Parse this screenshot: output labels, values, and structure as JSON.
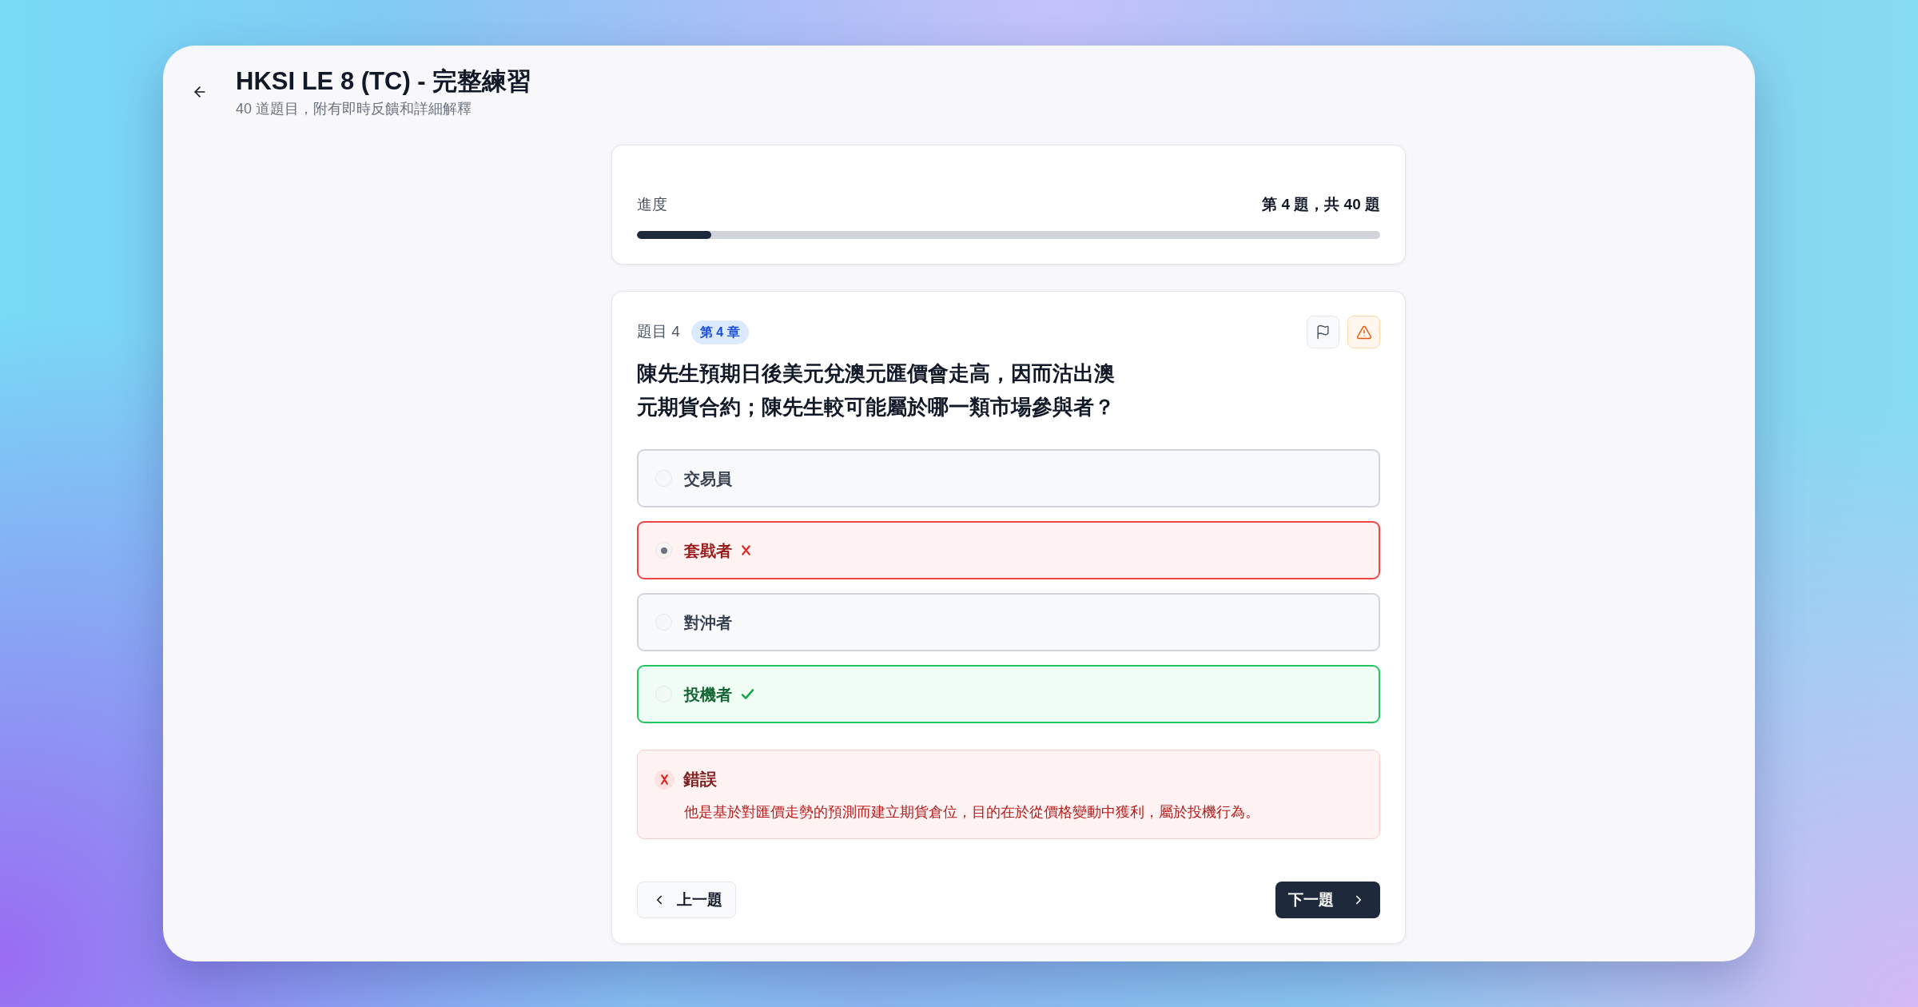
{
  "header": {
    "title": "HKSI LE 8 (TC) - 完整練習",
    "subtitle": "40 道題目，附有即時反饋和詳細解釋"
  },
  "progress": {
    "label": "進度",
    "count": "第 4 題，共 40 題",
    "level": 0.1
  },
  "question": {
    "number": "題目 4",
    "chapter": "第 4 章",
    "text": "陳先生預期日後美元兌澳元匯價會走高，因而沽出澳元期貨合約；陳先生較可能屬於哪一類市場參與者？",
    "options": [
      {
        "label": "交易員",
        "selected": false,
        "correct": false
      },
      {
        "label": "套戥者",
        "selected": true,
        "correct": false
      },
      {
        "label": "對沖者",
        "selected": false,
        "correct": false
      },
      {
        "label": "投機者",
        "selected": false,
        "correct": true
      }
    ]
  },
  "feedback": {
    "correct": false,
    "title": "錯誤",
    "explanation": "他是基於對匯價走勢的預測而建立期貨倉位，目的在於從價格變動中獲利，屬於投機行為。"
  },
  "navigation": {
    "previous": "上一題",
    "next": "下一題"
  }
}
